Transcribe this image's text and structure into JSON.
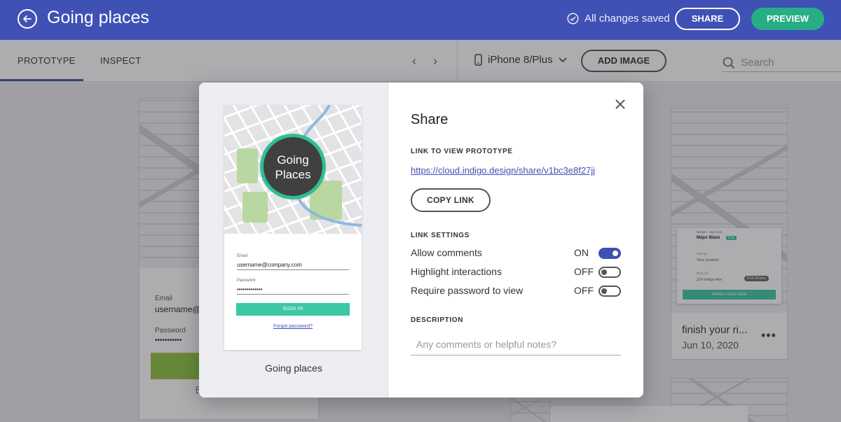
{
  "header": {
    "title": "Going places",
    "save_status": "All changes saved",
    "share_label": "SHARE",
    "preview_label": "PREVIEW"
  },
  "left_panel": {
    "tabs": [
      {
        "label": "PROTOTYPE",
        "active": true
      },
      {
        "label": "INSPECT",
        "active": false
      }
    ]
  },
  "toolbar": {
    "device": "iPhone 8/Plus",
    "add_image_label": "ADD IMAGE",
    "search_placeholder": "Search"
  },
  "background_screen": {
    "email_label": "Email",
    "email_value": "username@c",
    "password_label": "Password",
    "password_value": "•••••••••••",
    "forgot_partial": "F"
  },
  "cards": [
    {
      "title": "finish your ri...",
      "date": "Jun 10, 2020"
    }
  ],
  "card_preview": {
    "driver_meta": "Nissan - ABA 1111",
    "driver_name": "Major Blaze",
    "rating": "5 ★",
    "pickup_label": "Pick up",
    "pickup_value": "Your location",
    "dropoff_label": "Drop off",
    "dropoff_value": "224 Indigo Ave",
    "eta": "ETA 20mins",
    "finish_button": "FINISH YOUR RIDE"
  },
  "modal": {
    "title": "Share",
    "preview": {
      "logo_line1": "Going",
      "logo_line2": "Places",
      "email_label": "Email",
      "email_value": "username@company.com",
      "password_label": "Password",
      "password_value": "•••••••••••••",
      "signin_label": "SIGN IN",
      "forgot_label": "Forgot password?",
      "caption": "Going places"
    },
    "link_section_label": "LINK TO VIEW PROTOTYPE",
    "link_url": "https://cloud.indigo.design/share/v1bc3e8f27jj",
    "copy_link_label": "COPY LINK",
    "settings_label": "LINK SETTINGS",
    "settings": [
      {
        "name": "Allow comments",
        "state": "ON",
        "enabled": true
      },
      {
        "name": "Highlight interactions",
        "state": "OFF",
        "enabled": false
      },
      {
        "name": "Require password to view",
        "state": "OFF",
        "enabled": false
      }
    ],
    "description_label": "DESCRIPTION",
    "description_placeholder": "Any comments or helpful notes?"
  },
  "colors": {
    "header_bg": "#3f51b5",
    "preview_btn": "#27ae84",
    "accent": "#3f51b5",
    "logo_ring": "#2dbf92"
  }
}
